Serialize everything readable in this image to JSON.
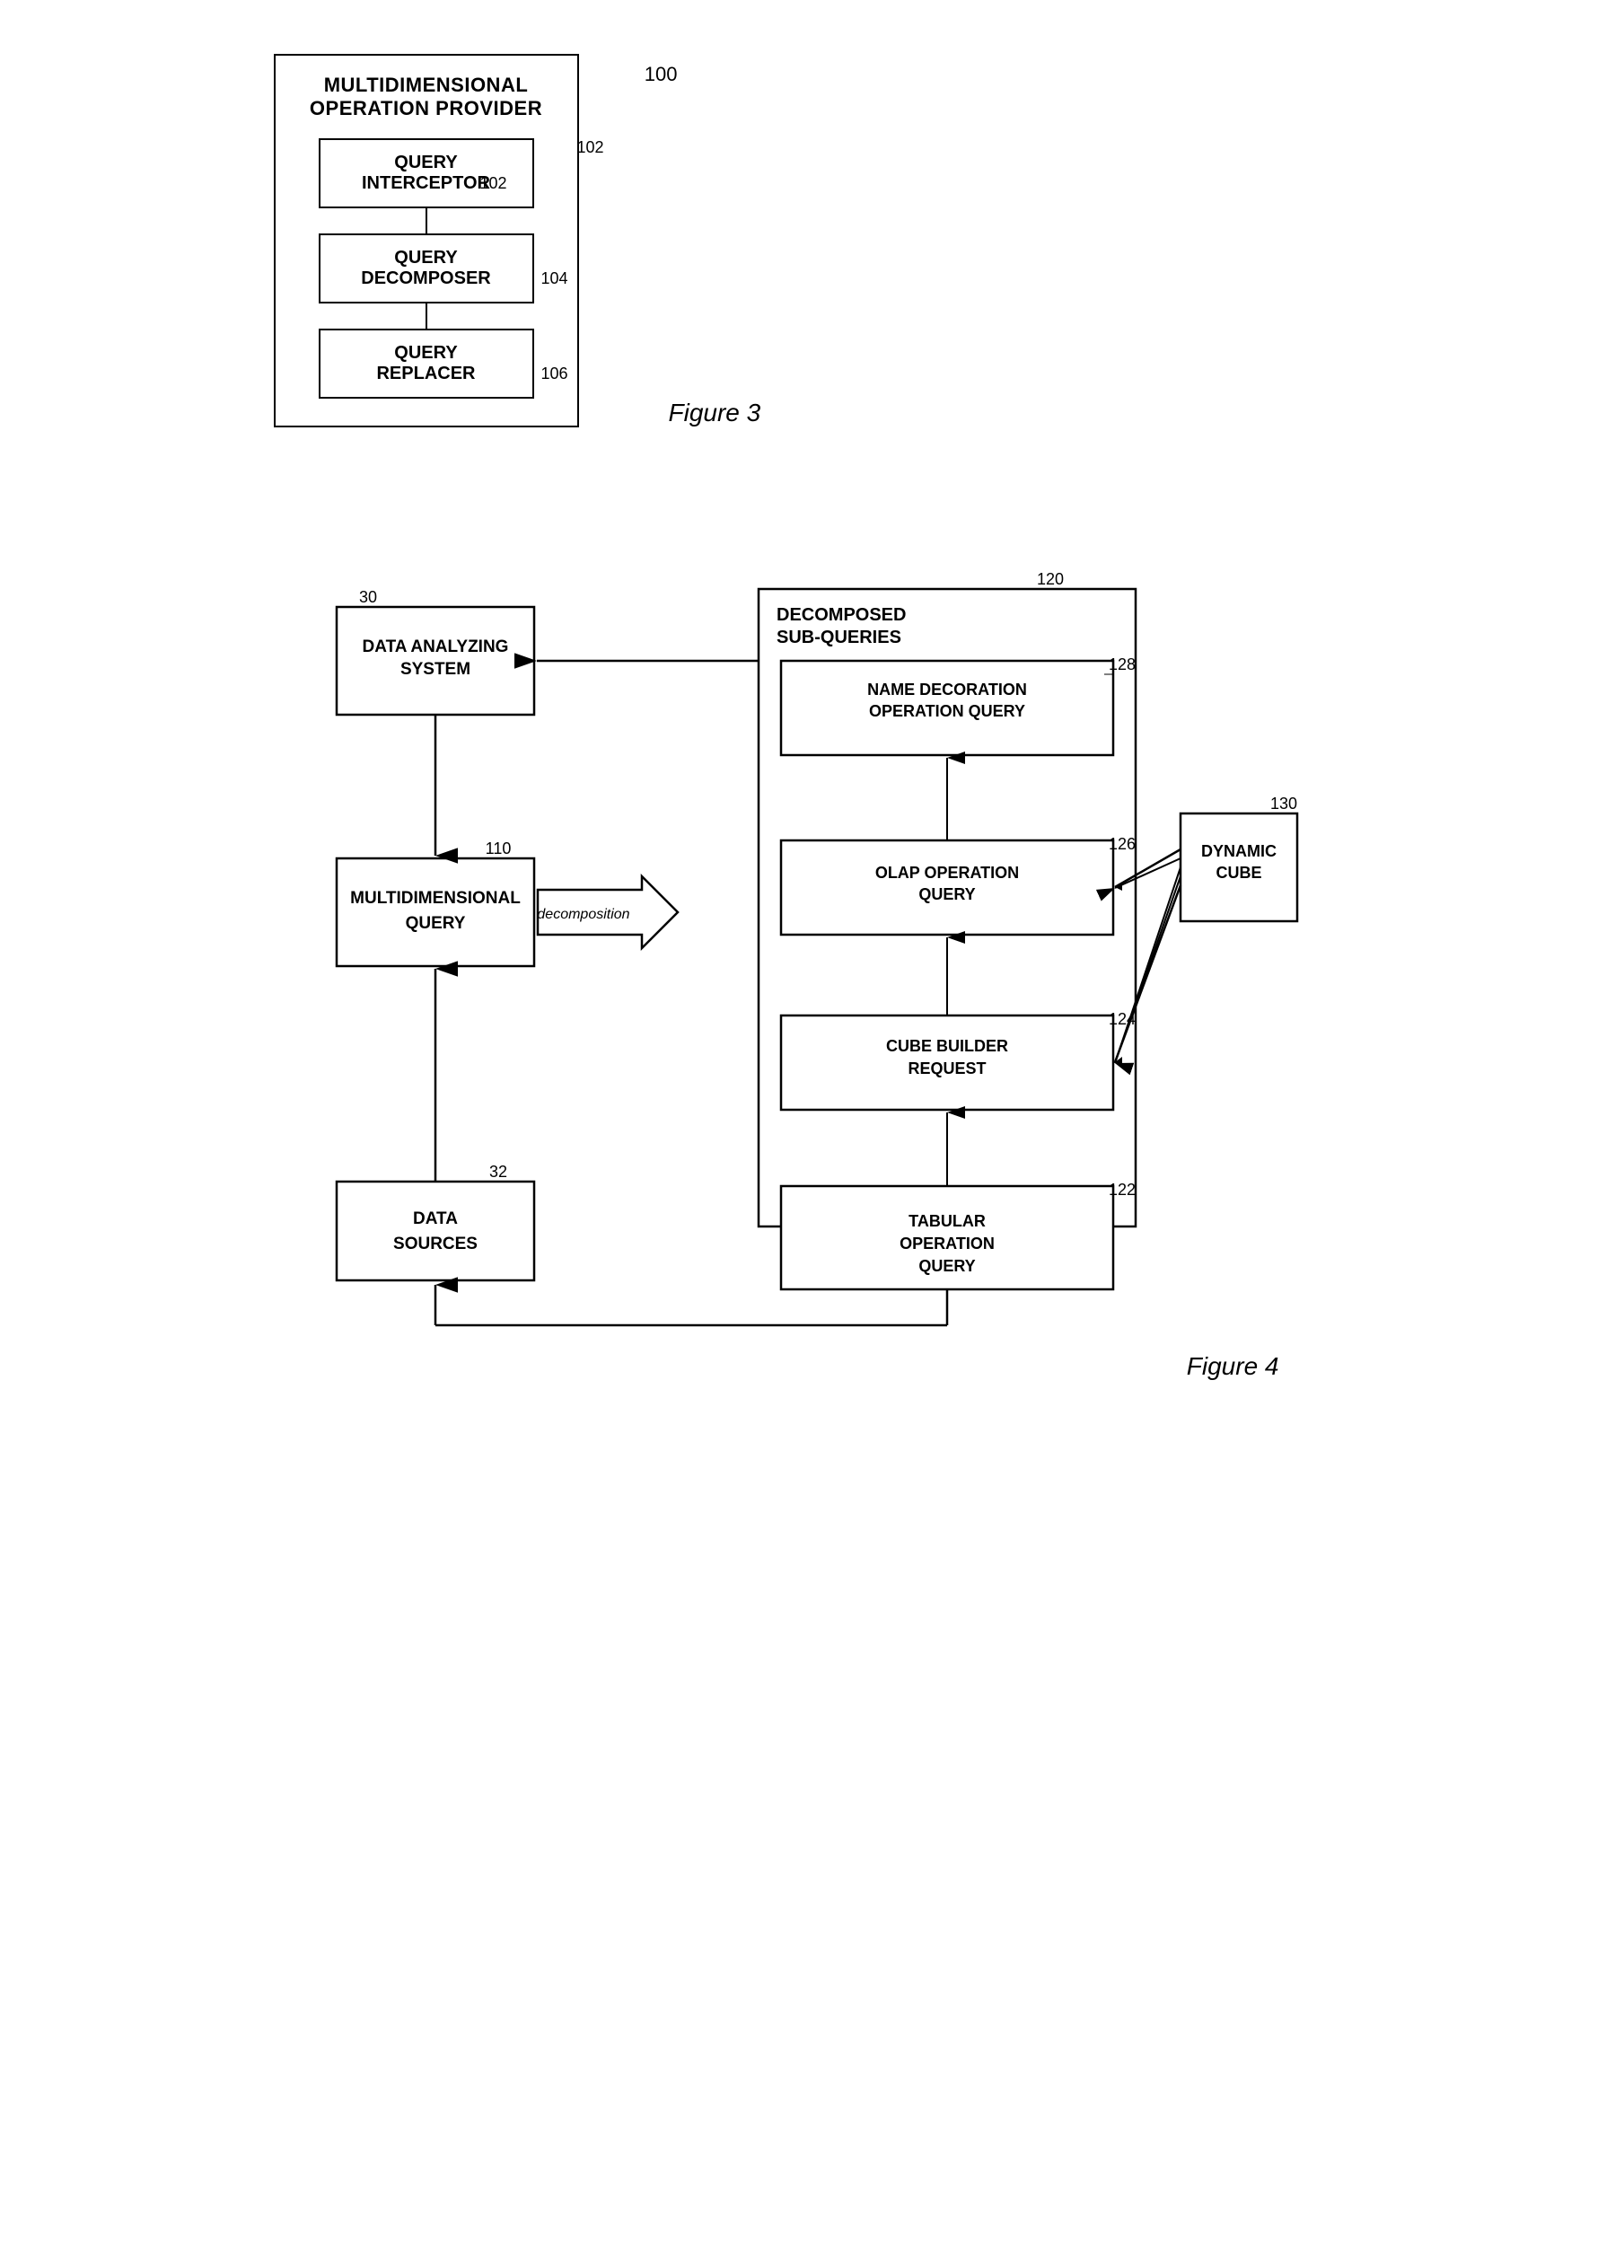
{
  "figure3": {
    "caption": "Figure 3",
    "ref_number": "100",
    "outer_title": "MULTIDIMENSIONAL\nOPERATION PROVIDER",
    "boxes": [
      {
        "label": "QUERY\nINTERCEPTOR",
        "ref": "102"
      },
      {
        "label": "QUERY\nDECOMPOSER",
        "ref": "104"
      },
      {
        "label": "QUERY\nREPLACER",
        "ref": "106"
      }
    ]
  },
  "figure4": {
    "caption": "Figure 4",
    "data_analyzing": {
      "label": "DATA ANALYZING\nSYSTEM",
      "ref": "30"
    },
    "multidim_query": {
      "label": "MULTIDIMENSIONAL\nQUERY",
      "ref": "110"
    },
    "data_sources": {
      "label": "DATA\nSOURCES",
      "ref": "32"
    },
    "decomposition_label": "decomposition",
    "decomposed_outer": {
      "title": "DECOMPOSED\nSUB-QUERIES",
      "ref": "120",
      "sub_queries": [
        {
          "label": "NAME DECORATION\nOPERATION QUERY",
          "ref": "128"
        },
        {
          "label": "OLAP OPERATION\nQUERY",
          "ref": "126"
        },
        {
          "label": "CUBE BUILDER\nREQUEST",
          "ref": "124"
        },
        {
          "label": "TABULAR\nOPERATION\nQUERY",
          "ref": "122"
        }
      ]
    },
    "dynamic_cube": {
      "label": "DYNAMIC\nCUBE",
      "ref": "130"
    }
  }
}
